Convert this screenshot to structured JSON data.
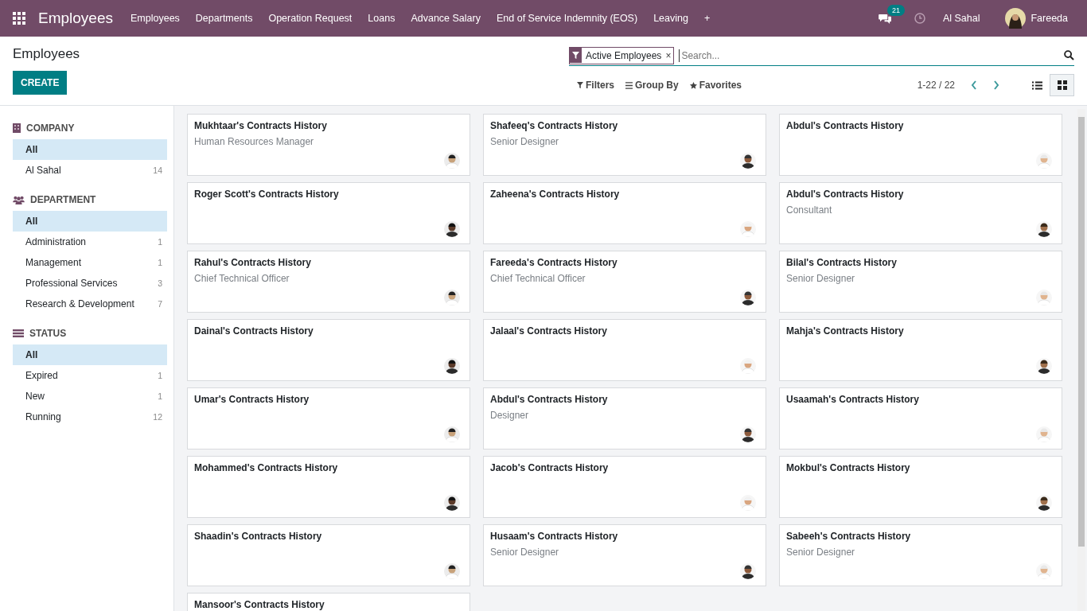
{
  "navbar": {
    "app_title": "Employees",
    "menu": [
      "Employees",
      "Departments",
      "Operation Request",
      "Loans",
      "Advance Salary",
      "End of Service Indemnity (EOS)",
      "Leaving",
      "+"
    ],
    "messages_badge": "21",
    "company": "Al Sahal",
    "user": "Fareeda"
  },
  "control_panel": {
    "breadcrumb": "Employees",
    "create_button": "CREATE",
    "facet": "Active Employees",
    "facet_remove": "×",
    "search": {
      "placeholder": "Search..."
    },
    "filters": "Filters",
    "group_by": "Group By",
    "favorites": "Favorites",
    "pager": "1-22 / 22",
    "views": [
      {
        "kind": "list",
        "selected": false
      },
      {
        "kind": "kanban",
        "selected": true
      }
    ]
  },
  "sidebar": [
    {
      "kind": "company",
      "title": "COMPANY",
      "items": [
        {
          "label": "All",
          "selected": true
        },
        {
          "label": "Al Sahal",
          "count": "14",
          "selected": false
        }
      ]
    },
    {
      "kind": "department",
      "title": "DEPARTMENT",
      "items": [
        {
          "label": "All",
          "selected": true
        },
        {
          "label": "Administration",
          "count": "1",
          "selected": false
        },
        {
          "label": "Management",
          "count": "1",
          "selected": false
        },
        {
          "label": "Professional Services",
          "count": "3",
          "selected": false
        },
        {
          "label": "Research & Development",
          "count": "7",
          "selected": false
        }
      ]
    },
    {
      "kind": "status",
      "title": "STATUS",
      "items": [
        {
          "label": "All",
          "selected": true
        },
        {
          "label": "Expired",
          "count": "1",
          "selected": false
        },
        {
          "label": "New",
          "count": "1",
          "selected": false
        },
        {
          "label": "Running",
          "count": "12",
          "selected": false
        }
      ]
    }
  ],
  "cards": [
    {
      "title": "Mukhtaar's Contracts History",
      "subtitle": "Human Resources Manager"
    },
    {
      "title": "Shafeeq's Contracts History",
      "subtitle": "Senior Designer"
    },
    {
      "title": "Abdul's Contracts History"
    },
    {
      "title": "Roger Scott's Contracts History"
    },
    {
      "title": "Zaheena's Contracts History"
    },
    {
      "title": "Abdul's Contracts History",
      "subtitle": "Consultant"
    },
    {
      "title": "Rahul's Contracts History",
      "subtitle": "Chief Technical Officer"
    },
    {
      "title": "Fareeda's Contracts History",
      "subtitle": "Chief Technical Officer"
    },
    {
      "title": "Bilal's Contracts History",
      "subtitle": "Senior Designer"
    },
    {
      "title": "Dainal's Contracts History"
    },
    {
      "title": "Jalaal's Contracts History"
    },
    {
      "title": "Mahja's Contracts History"
    },
    {
      "title": "Umar's Contracts History"
    },
    {
      "title": "Abdul's Contracts History",
      "subtitle": "Designer"
    },
    {
      "title": "Usaamah's Contracts History"
    },
    {
      "title": "Mohammed's Contracts History"
    },
    {
      "title": "Jacob's Contracts History"
    },
    {
      "title": "Mokbul's Contracts History"
    },
    {
      "title": "Shaadin's Contracts History"
    },
    {
      "title": "Husaam's Contracts History",
      "subtitle": "Senior Designer"
    },
    {
      "title": "Sabeeh's Contracts History",
      "subtitle": "Senior Designer"
    },
    {
      "title": "Mansoor's Contracts History"
    }
  ]
}
